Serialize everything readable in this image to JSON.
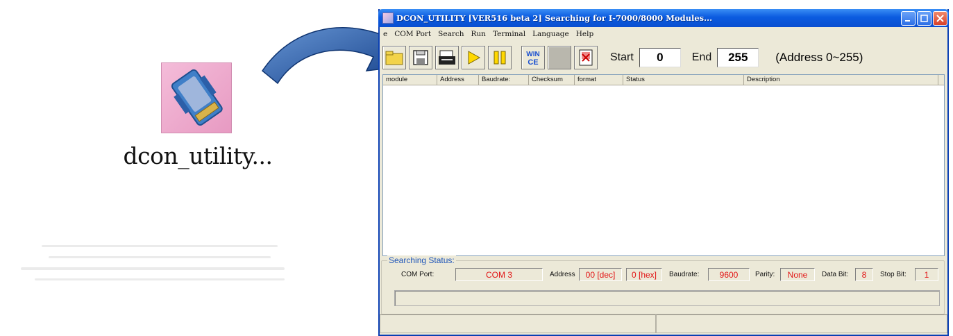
{
  "desktop": {
    "icon_name": "dcon-utility-module-icon",
    "label": "dcon_utility..."
  },
  "window": {
    "title": "DCON_UTILITY [VER516 beta 2] Searching for I-7000/8000 Modules...",
    "menu": [
      "e",
      "COM Port",
      "Search",
      "Run",
      "Terminal",
      "Language",
      "Help"
    ],
    "toolbar": {
      "start_label": "Start",
      "start_value": "0",
      "end_label": "End",
      "end_value": "255",
      "range_note": "(Address 0~255)"
    },
    "table": {
      "columns": [
        "module",
        "Address",
        "Baudrate:",
        "Checksum",
        "format",
        "Status",
        "Description"
      ],
      "rows": []
    },
    "status": {
      "group_title": "Searching Status:",
      "com_port_label": "COM Port:",
      "com_port_value": "COM 3",
      "address_label": "Address",
      "address_dec": "00 [dec]",
      "address_hex": "0 [hex]",
      "baudrate_label": "Baudrate:",
      "baudrate_value": "9600",
      "parity_label": "Parity:",
      "parity_value": "None",
      "databit_label": "Data Bit:",
      "databit_value": "8",
      "stopbit_label": "Stop Bit:",
      "stopbit_value": "1"
    }
  },
  "colors": {
    "title_bar": "#0b5be0",
    "status_value": "#e21515",
    "arrow": "#1d5aa8"
  }
}
